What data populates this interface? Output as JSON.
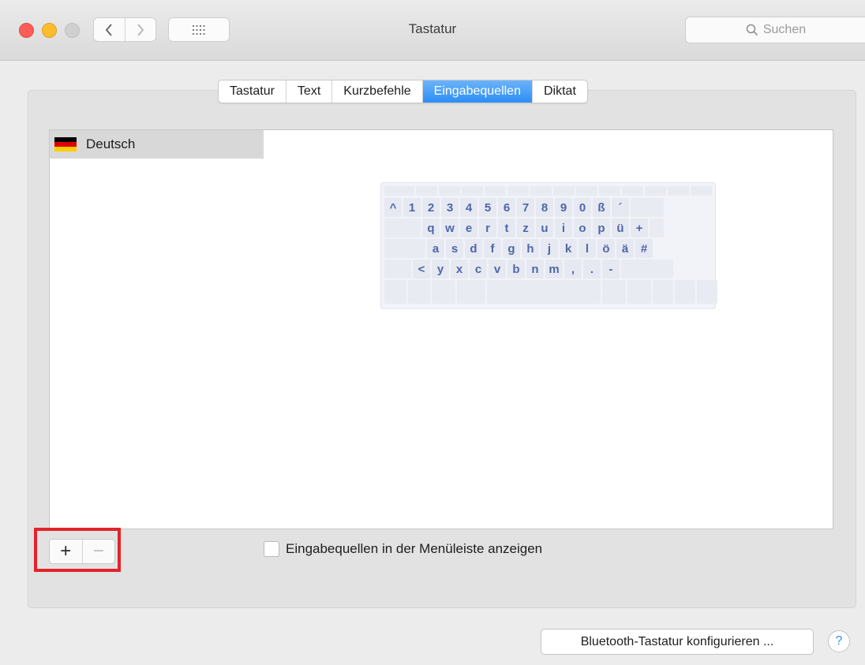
{
  "window": {
    "title": "Tastatur"
  },
  "search": {
    "placeholder": "Suchen"
  },
  "tabs": [
    {
      "label": "Tastatur"
    },
    {
      "label": "Text"
    },
    {
      "label": "Kurzbefehle"
    },
    {
      "label": "Eingabequellen",
      "active": true
    },
    {
      "label": "Diktat"
    }
  ],
  "input_sources": [
    {
      "label": "Deutsch",
      "icon": "german-flag-icon"
    }
  ],
  "keyboard_preview": {
    "row1": [
      "^",
      "1",
      "2",
      "3",
      "4",
      "5",
      "6",
      "7",
      "8",
      "9",
      "0",
      "ß",
      "´"
    ],
    "row2": [
      "q",
      "w",
      "e",
      "r",
      "t",
      "z",
      "u",
      "i",
      "o",
      "p",
      "ü",
      "+"
    ],
    "row3": [
      "a",
      "s",
      "d",
      "f",
      "g",
      "h",
      "j",
      "k",
      "l",
      "ö",
      "ä",
      "#"
    ],
    "row4": [
      "<",
      "y",
      "x",
      "c",
      "v",
      "b",
      "n",
      "m",
      ",",
      ".",
      "-"
    ]
  },
  "buttons": {
    "add": "+",
    "remove": "−",
    "bluetooth": "Bluetooth-Tastatur konfigurieren ...",
    "help": "?"
  },
  "checkbox": {
    "label": "Eingabequellen in der Menüleiste anzeigen",
    "checked": false
  },
  "colors": {
    "accent": "#2b8ef5",
    "highlight_box": "#e2242a",
    "key_text": "#4f67a7"
  }
}
